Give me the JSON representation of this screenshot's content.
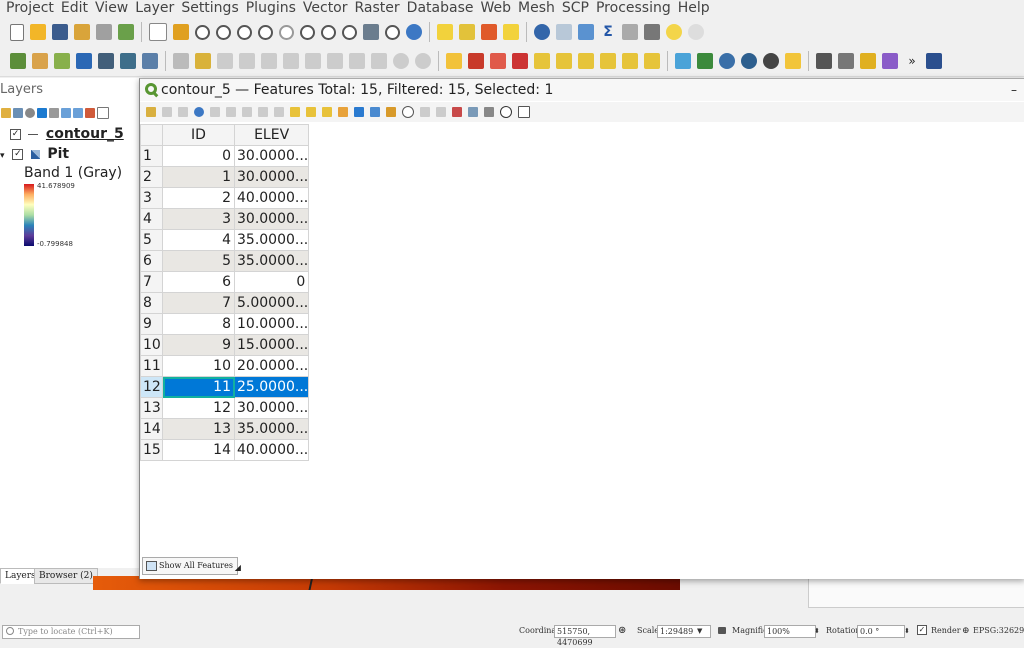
{
  "menubar": [
    "Project",
    "Edit",
    "View",
    "Layer",
    "Settings",
    "Plugins",
    "Vector",
    "Raster",
    "Database",
    "Web",
    "Mesh",
    "SCP",
    "Processing",
    "Help"
  ],
  "layers_panel": {
    "title": "Layers",
    "layers": [
      {
        "name": "contour_5",
        "checked": "✓"
      },
      {
        "name": "Pit",
        "checked": "✓",
        "band": "Band 1 (Gray)",
        "max": "41.678909",
        "min": "-0.799848"
      }
    ],
    "tabs": [
      "Layers",
      "Browser (2)"
    ]
  },
  "attribute_table": {
    "title": "contour_5 — Features Total: 15, Filtered: 15, Selected: 1",
    "columns": [
      "ID",
      "ELEV"
    ],
    "rows": [
      {
        "n": "1",
        "id": "0",
        "elev": "30.0000..."
      },
      {
        "n": "2",
        "id": "1",
        "elev": "30.0000..."
      },
      {
        "n": "3",
        "id": "2",
        "elev": "40.0000..."
      },
      {
        "n": "4",
        "id": "3",
        "elev": "30.0000..."
      },
      {
        "n": "5",
        "id": "4",
        "elev": "35.0000..."
      },
      {
        "n": "6",
        "id": "5",
        "elev": "35.0000..."
      },
      {
        "n": "7",
        "id": "6",
        "elev": "0"
      },
      {
        "n": "8",
        "id": "7",
        "elev": "5.00000..."
      },
      {
        "n": "9",
        "id": "8",
        "elev": "10.0000..."
      },
      {
        "n": "10",
        "id": "9",
        "elev": "15.0000..."
      },
      {
        "n": "11",
        "id": "10",
        "elev": "20.0000..."
      },
      {
        "n": "12",
        "id": "11",
        "elev": "25.0000...",
        "selected": true
      },
      {
        "n": "13",
        "id": "12",
        "elev": "30.0000..."
      },
      {
        "n": "14",
        "id": "13",
        "elev": "35.0000..."
      },
      {
        "n": "15",
        "id": "14",
        "elev": "40.0000..."
      }
    ],
    "show_all_label": "Show All Features"
  },
  "statusbar": {
    "locate_placeholder": "Type to locate (Ctrl+K)",
    "coordinate_label": "Coordinate",
    "coordinate_value": "515750, 4470699",
    "scale_label": "Scale",
    "scale_value": "1:29489",
    "magnifier_label": "Magnifier",
    "magnifier_value": "100%",
    "rotation_label": "Rotation",
    "rotation_value": "0.0 °",
    "render_label": "Render",
    "crs": "EPSG:32629"
  },
  "colors": {
    "selection": "#0078d7",
    "qgis_green": "#589632"
  }
}
